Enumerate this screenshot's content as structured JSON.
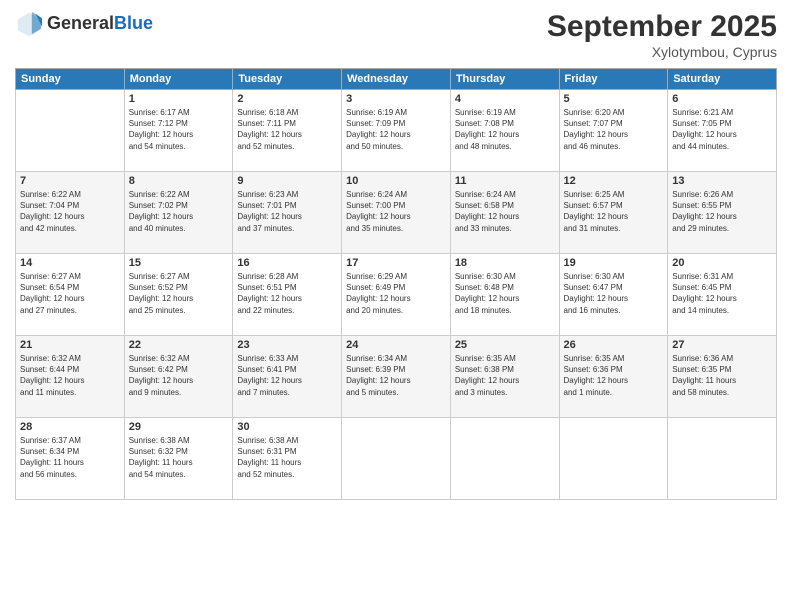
{
  "header": {
    "logo_line1": "General",
    "logo_line2": "Blue",
    "month": "September 2025",
    "location": "Xylotymbou, Cyprus"
  },
  "weekdays": [
    "Sunday",
    "Monday",
    "Tuesday",
    "Wednesday",
    "Thursday",
    "Friday",
    "Saturday"
  ],
  "weeks": [
    [
      {
        "day": "",
        "info": ""
      },
      {
        "day": "1",
        "info": "Sunrise: 6:17 AM\nSunset: 7:12 PM\nDaylight: 12 hours\nand 54 minutes."
      },
      {
        "day": "2",
        "info": "Sunrise: 6:18 AM\nSunset: 7:11 PM\nDaylight: 12 hours\nand 52 minutes."
      },
      {
        "day": "3",
        "info": "Sunrise: 6:19 AM\nSunset: 7:09 PM\nDaylight: 12 hours\nand 50 minutes."
      },
      {
        "day": "4",
        "info": "Sunrise: 6:19 AM\nSunset: 7:08 PM\nDaylight: 12 hours\nand 48 minutes."
      },
      {
        "day": "5",
        "info": "Sunrise: 6:20 AM\nSunset: 7:07 PM\nDaylight: 12 hours\nand 46 minutes."
      },
      {
        "day": "6",
        "info": "Sunrise: 6:21 AM\nSunset: 7:05 PM\nDaylight: 12 hours\nand 44 minutes."
      }
    ],
    [
      {
        "day": "7",
        "info": "Sunrise: 6:22 AM\nSunset: 7:04 PM\nDaylight: 12 hours\nand 42 minutes."
      },
      {
        "day": "8",
        "info": "Sunrise: 6:22 AM\nSunset: 7:02 PM\nDaylight: 12 hours\nand 40 minutes."
      },
      {
        "day": "9",
        "info": "Sunrise: 6:23 AM\nSunset: 7:01 PM\nDaylight: 12 hours\nand 37 minutes."
      },
      {
        "day": "10",
        "info": "Sunrise: 6:24 AM\nSunset: 7:00 PM\nDaylight: 12 hours\nand 35 minutes."
      },
      {
        "day": "11",
        "info": "Sunrise: 6:24 AM\nSunset: 6:58 PM\nDaylight: 12 hours\nand 33 minutes."
      },
      {
        "day": "12",
        "info": "Sunrise: 6:25 AM\nSunset: 6:57 PM\nDaylight: 12 hours\nand 31 minutes."
      },
      {
        "day": "13",
        "info": "Sunrise: 6:26 AM\nSunset: 6:55 PM\nDaylight: 12 hours\nand 29 minutes."
      }
    ],
    [
      {
        "day": "14",
        "info": "Sunrise: 6:27 AM\nSunset: 6:54 PM\nDaylight: 12 hours\nand 27 minutes."
      },
      {
        "day": "15",
        "info": "Sunrise: 6:27 AM\nSunset: 6:52 PM\nDaylight: 12 hours\nand 25 minutes."
      },
      {
        "day": "16",
        "info": "Sunrise: 6:28 AM\nSunset: 6:51 PM\nDaylight: 12 hours\nand 22 minutes."
      },
      {
        "day": "17",
        "info": "Sunrise: 6:29 AM\nSunset: 6:49 PM\nDaylight: 12 hours\nand 20 minutes."
      },
      {
        "day": "18",
        "info": "Sunrise: 6:30 AM\nSunset: 6:48 PM\nDaylight: 12 hours\nand 18 minutes."
      },
      {
        "day": "19",
        "info": "Sunrise: 6:30 AM\nSunset: 6:47 PM\nDaylight: 12 hours\nand 16 minutes."
      },
      {
        "day": "20",
        "info": "Sunrise: 6:31 AM\nSunset: 6:45 PM\nDaylight: 12 hours\nand 14 minutes."
      }
    ],
    [
      {
        "day": "21",
        "info": "Sunrise: 6:32 AM\nSunset: 6:44 PM\nDaylight: 12 hours\nand 11 minutes."
      },
      {
        "day": "22",
        "info": "Sunrise: 6:32 AM\nSunset: 6:42 PM\nDaylight: 12 hours\nand 9 minutes."
      },
      {
        "day": "23",
        "info": "Sunrise: 6:33 AM\nSunset: 6:41 PM\nDaylight: 12 hours\nand 7 minutes."
      },
      {
        "day": "24",
        "info": "Sunrise: 6:34 AM\nSunset: 6:39 PM\nDaylight: 12 hours\nand 5 minutes."
      },
      {
        "day": "25",
        "info": "Sunrise: 6:35 AM\nSunset: 6:38 PM\nDaylight: 12 hours\nand 3 minutes."
      },
      {
        "day": "26",
        "info": "Sunrise: 6:35 AM\nSunset: 6:36 PM\nDaylight: 12 hours\nand 1 minute."
      },
      {
        "day": "27",
        "info": "Sunrise: 6:36 AM\nSunset: 6:35 PM\nDaylight: 11 hours\nand 58 minutes."
      }
    ],
    [
      {
        "day": "28",
        "info": "Sunrise: 6:37 AM\nSunset: 6:34 PM\nDaylight: 11 hours\nand 56 minutes."
      },
      {
        "day": "29",
        "info": "Sunrise: 6:38 AM\nSunset: 6:32 PM\nDaylight: 11 hours\nand 54 minutes."
      },
      {
        "day": "30",
        "info": "Sunrise: 6:38 AM\nSunset: 6:31 PM\nDaylight: 11 hours\nand 52 minutes."
      },
      {
        "day": "",
        "info": ""
      },
      {
        "day": "",
        "info": ""
      },
      {
        "day": "",
        "info": ""
      },
      {
        "day": "",
        "info": ""
      }
    ]
  ]
}
